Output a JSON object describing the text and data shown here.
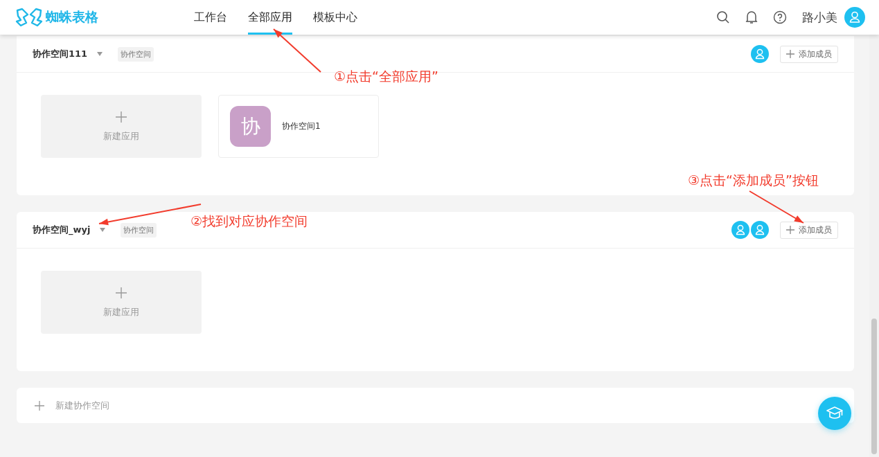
{
  "brand": {
    "name": "蜘蛛表格"
  },
  "nav": [
    {
      "label": "工作台",
      "selected": false
    },
    {
      "label": "全部应用",
      "selected": true
    },
    {
      "label": "模板中心",
      "selected": false
    }
  ],
  "user": {
    "name": "路小美"
  },
  "spaces": [
    {
      "name": "协作空间111",
      "tag": "协作空间",
      "members": [
        {
          "kind": "avatar"
        }
      ],
      "add_label": "添加成员",
      "new_app_label": "新建应用",
      "apps": [
        {
          "initial": "协",
          "name": "协作空间1",
          "color": "#c9a0c8"
        }
      ]
    },
    {
      "name": "协作空间_wyj",
      "tag": "协作空间",
      "members": [
        {
          "kind": "avatar"
        },
        {
          "kind": "avatar"
        }
      ],
      "add_label": "添加成员",
      "new_app_label": "新建应用"
    }
  ],
  "new_space_label": "新建协作空间",
  "annotations": [
    "①点击“全部应用”",
    "②找到对应协作空间",
    "③点击“添加成员”按钮"
  ]
}
